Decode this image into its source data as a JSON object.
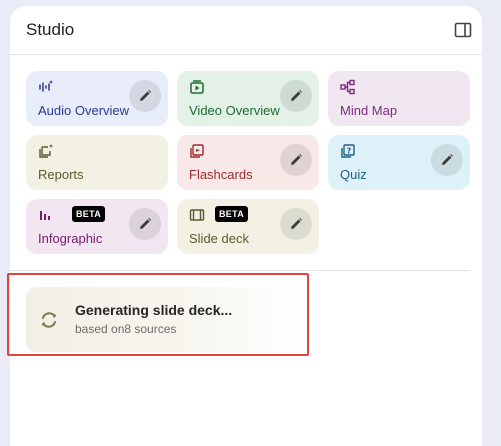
{
  "studio": {
    "title": "Studio",
    "toggle_icon": "panel-toggle-icon"
  },
  "cards": [
    {
      "label": "Audio Overview",
      "icon": "audio-waveform-icon",
      "bg": "#e9ecf9",
      "color": "#2b3a8f",
      "editable": true,
      "beta": false
    },
    {
      "label": "Video Overview",
      "icon": "video-play-icon",
      "bg": "#e3f1e6",
      "color": "#1e6b33",
      "editable": true,
      "beta": false
    },
    {
      "label": "Mind Map",
      "icon": "mind-map-icon",
      "bg": "#f1e7f1",
      "color": "#7a2c7e",
      "editable": false,
      "beta": false
    },
    {
      "label": "Reports",
      "icon": "reports-icon",
      "bg": "#f2f1e4",
      "color": "#5c5a2e",
      "editable": false,
      "beta": false
    },
    {
      "label": "Flashcards",
      "icon": "flashcards-icon",
      "bg": "#f8e8e7",
      "color": "#9b2c2c",
      "editable": true,
      "beta": false
    },
    {
      "label": "Quiz",
      "icon": "quiz-icon",
      "bg": "#dff1f8",
      "color": "#1b5e86",
      "editable": true,
      "beta": false
    },
    {
      "label": "Infographic",
      "icon": "infographic-icon",
      "bg": "#f2e6f1",
      "color": "#74206f",
      "editable": true,
      "beta": true,
      "beta_label": "BETA"
    },
    {
      "label": "Slide deck",
      "icon": "slide-deck-icon",
      "bg": "#f2f1e4",
      "color": "#5c5a2e",
      "editable": true,
      "beta": true,
      "beta_label": "BETA"
    }
  ],
  "generating": {
    "title": "Generating slide deck...",
    "subtitle": "based on8 sources",
    "icon": "sync-spinner-icon"
  },
  "colors": {
    "accent_highlight": "#e4433b",
    "page_background": "#e9ecf6"
  }
}
